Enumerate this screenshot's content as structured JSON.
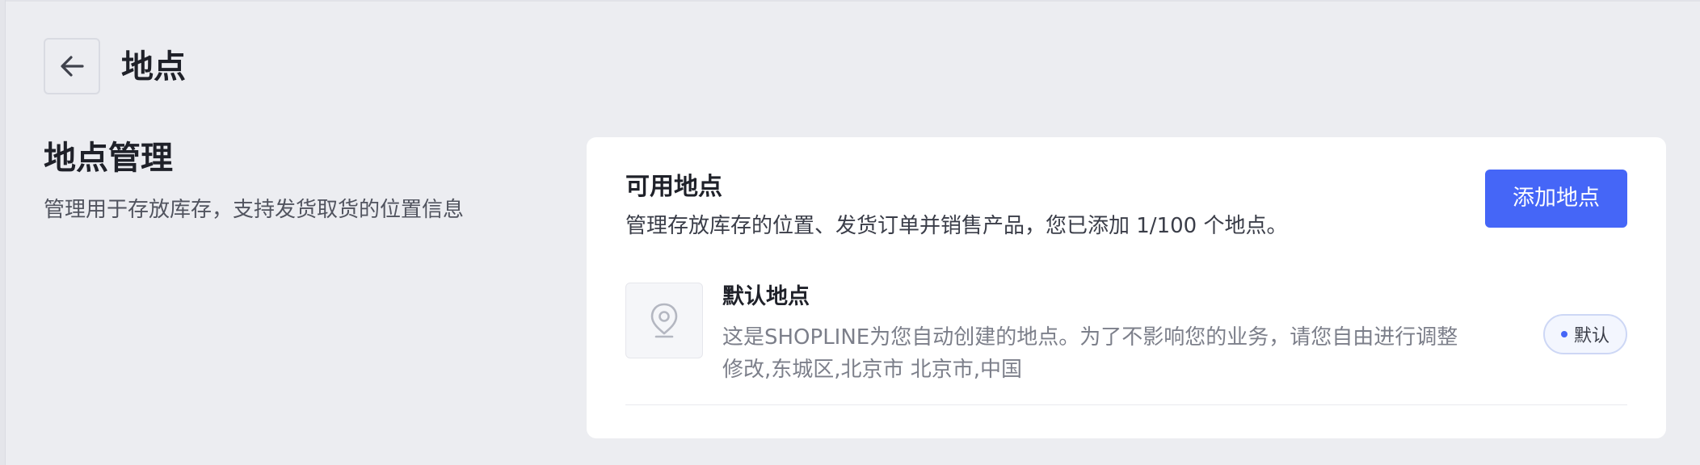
{
  "header": {
    "title": "地点",
    "back_icon": "arrow-left-icon"
  },
  "section": {
    "title": "地点管理",
    "description": "管理用于存放库存，支持发货取货的位置信息"
  },
  "card": {
    "title": "可用地点",
    "description": "管理存放库存的位置、发货订单并销售产品，您已添加 1/100 个地点。",
    "add_button_label": "添加地点",
    "locations": [
      {
        "name": "默认地点",
        "description_line1": "这是SHOPLINE为您自动创建的地点。为了不影响您的业务，请您自由进行调整",
        "description_line2": "修改,东城区,北京市 北京市,中国",
        "badge": "默认",
        "icon": "location-pin-icon"
      }
    ]
  },
  "colors": {
    "background": "#ECEDF1",
    "card": "#FFFFFF",
    "accent": "#4566F7",
    "badge_border": "#CDD7F5"
  }
}
